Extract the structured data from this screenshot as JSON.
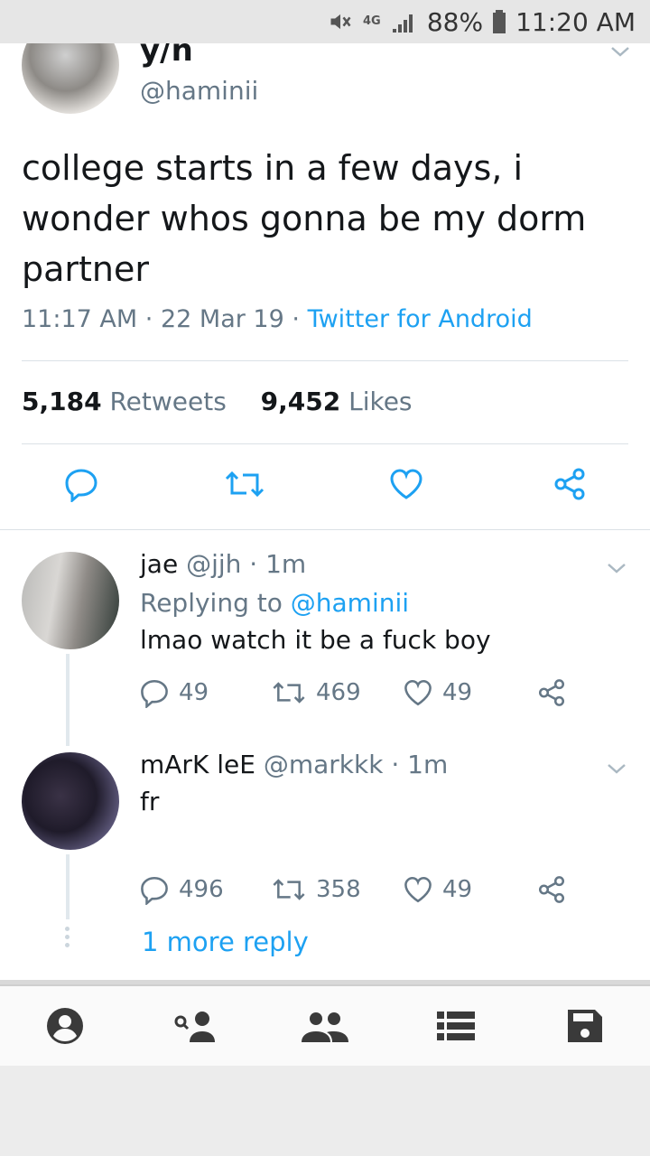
{
  "status_bar": {
    "network": "4G",
    "battery": "88%",
    "time": "11:20 AM"
  },
  "tweet": {
    "name": "y/n",
    "handle": "@haminii",
    "text": "college starts in a few days, i wonder whos gonna be my dorm partner",
    "time": "11:17 AM",
    "date": "22 Mar 19",
    "source": "Twitter for Android",
    "sep": "·",
    "retweets_count": "5,184",
    "retweets_label": "Retweets",
    "likes_count": "9,452",
    "likes_label": "Likes"
  },
  "replies": [
    {
      "name": "jae",
      "handle": "@jjh",
      "time": "1m",
      "replying_prefix": "Replying to",
      "replying_to": "@haminii",
      "text": "lmao watch it be a fuck boy",
      "reply_count": "49",
      "retweet_count": "469",
      "like_count": "49"
    },
    {
      "name": "mArK leE",
      "handle": "@markkk",
      "time": "1m",
      "text": "fr",
      "reply_count": "496",
      "retweet_count": "358",
      "like_count": "49"
    }
  ],
  "more_replies": "1 more reply",
  "icons": {
    "reply": "reply-icon",
    "retweet": "retweet-icon",
    "like": "heart-icon",
    "share": "share-icon",
    "nav": [
      "profile-icon",
      "user-search-icon",
      "people-icon",
      "list-icon",
      "save-icon"
    ]
  },
  "colors": {
    "link": "#1da1f2",
    "muted": "#657786",
    "text": "#14171a"
  }
}
